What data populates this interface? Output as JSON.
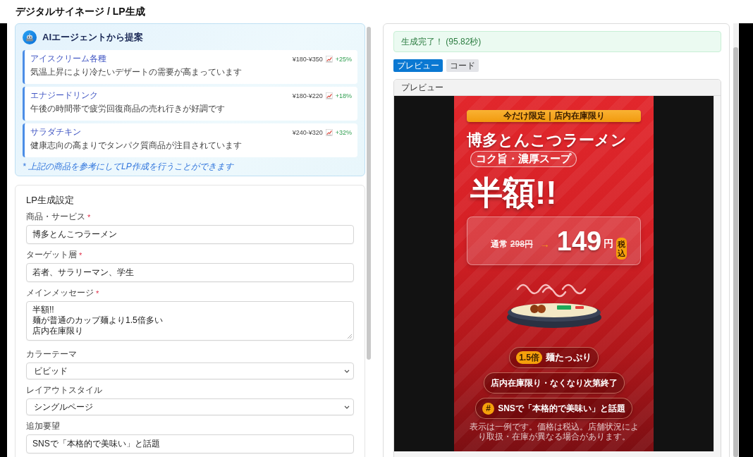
{
  "page": {
    "title": "デジタルサイネージ / LP生成"
  },
  "suggestions": {
    "title": "AIエージェントから提案",
    "items": [
      {
        "name": "アイスクリーム各種",
        "reason": "気温上昇により冷たいデザートの需要が高まっています",
        "price": "¥180-¥350",
        "trend": "+25%"
      },
      {
        "name": "エナジードリンク",
        "reason": "午後の時間帯で疲労回復商品の売れ行きが好調です",
        "price": "¥180-¥220",
        "trend": "+18%"
      },
      {
        "name": "サラダチキン",
        "reason": "健康志向の高まりでタンパク質商品が注目されています",
        "price": "¥240-¥320",
        "trend": "+32%"
      }
    ],
    "note": "* 上記の商品を参考にしてLP作成を行うことができます"
  },
  "form": {
    "title": "LP生成設定",
    "required_mark": "*",
    "fields": [
      {
        "kind": "input",
        "label": "商品・サービス",
        "required": true,
        "value": "博多とんこつラーメン"
      },
      {
        "kind": "input",
        "label": "ターゲット層",
        "required": true,
        "value": "若者、サラリーマン、学生"
      },
      {
        "kind": "textarea",
        "label": "メインメッセージ",
        "required": true,
        "lines": [
          "半額!!",
          "麺が普通のカップ麺より1.5倍多い",
          "店内在庫限り"
        ]
      },
      {
        "kind": "select",
        "label": "カラーテーマ",
        "required": false,
        "value": "ビビッド"
      },
      {
        "kind": "select",
        "label": "レイアウトスタイル",
        "required": false,
        "value": "シングルページ"
      },
      {
        "kind": "input",
        "label": "追加要望",
        "required": false,
        "value": "SNSで「本格的で美味い」と話題"
      }
    ]
  },
  "result": {
    "status": "生成完了！ (95.82秒)",
    "tabs": [
      {
        "label": "プレビュー",
        "selected": true
      },
      {
        "label": "コード",
        "selected": false
      }
    ],
    "preview": {
      "title": "プレビュー",
      "poster": {
        "banner": "今だけ限定｜店内在庫限り",
        "title": "博多とんこつラーメン",
        "tagline": "コク旨・濃厚スープ",
        "headline": "半額!!",
        "price": {
          "regular_label": "通常",
          "regular": "298円",
          "arrow": "→",
          "sale": "149",
          "unit": "円",
          "tax": "税込"
        },
        "features": [
          {
            "kind": "badge",
            "badge": "1.5倍",
            "text": "麺たっぷり"
          },
          {
            "kind": "plain",
            "text": "店内在庫限り・なくなり次第終了"
          },
          {
            "kind": "hashtag",
            "badge": "#",
            "text": "SNSで「本格的で美味い」と話題"
          }
        ],
        "footnote": "表示は一例です。価格は税込。店舗状況により取扱・在庫が異なる場合があります。"
      }
    }
  }
}
